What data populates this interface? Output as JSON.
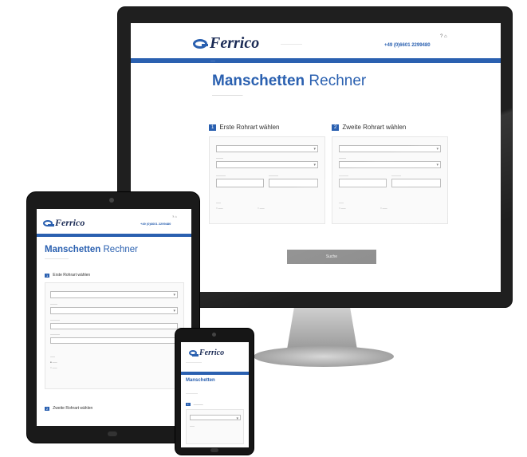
{
  "brand": {
    "logo_text": "Ferrico",
    "primary": "#2a60b0",
    "dark": "#1b2b55"
  },
  "desktop": {
    "phone": "+49 (0)6601 2299480",
    "utility": "? ⌂",
    "title_bold": "Manschetten",
    "title_light": "Rechner",
    "panel1_num": "1",
    "panel1_title": "Erste Rohrart wählen",
    "panel2_num": "2",
    "panel2_title": "Zweite Rohrart wählen",
    "submit_label": "Suche"
  },
  "tablet": {
    "phone": "+49 (0)6601 2299480",
    "utility": "? ⌂",
    "title_bold": "Manschetten",
    "title_light": "Rechner",
    "panel1_num": "1",
    "panel1_title": "Erste Rohrart wählen",
    "panel2_num": "2",
    "panel2_title": "Zweite Rohrart wählen"
  },
  "phone": {
    "title": "Manschetten",
    "panel1_num": "1"
  }
}
